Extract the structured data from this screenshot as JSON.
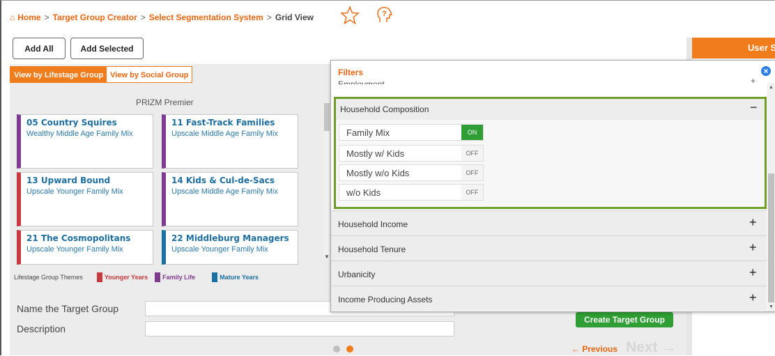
{
  "breadcrumb": {
    "home": "Home",
    "items": [
      "Target Group Creator",
      "Select Segmentation System"
    ],
    "current": "Grid View",
    "separator": ">"
  },
  "icons": {
    "home": "home-icon",
    "star": "star-icon",
    "help": "help-head-icon",
    "close": "close-icon"
  },
  "toolbar": {
    "add_all": "Add All",
    "add_selected": "Add Selected",
    "user_tab": "User S"
  },
  "view_tabs": [
    {
      "label": "View by Lifestage Group",
      "active": true
    },
    {
      "label": "View by Social Group",
      "active": false
    }
  ],
  "grid": {
    "title": "PRIZM Premier",
    "segments": [
      {
        "name": "05 Country Squires",
        "desc": "Wealthy Middle Age Family Mix",
        "theme": "purple"
      },
      {
        "name": "11 Fast-Track Families",
        "desc": "Upscale Middle Age Family Mix",
        "theme": "purple"
      },
      {
        "name": "13 Upward Bound",
        "desc": "Upscale Younger Family Mix",
        "theme": "red"
      },
      {
        "name": "14 Kids & Cul-de-Sacs",
        "desc": "Upscale Middle Age Family Mix",
        "theme": "purple"
      },
      {
        "name": "21 The Cosmopolitans",
        "desc": "Upscale Younger Family Mix",
        "theme": "red"
      },
      {
        "name": "22 Middleburg Managers",
        "desc": "Upscale Younger Family Mix",
        "theme": "blue"
      }
    ]
  },
  "legend": {
    "label": "Lifestage Group Themes",
    "items": [
      {
        "label": "Younger Years",
        "color": "#c8383f"
      },
      {
        "label": "Family Life",
        "color": "#7d3a8e"
      },
      {
        "label": "Mature Years",
        "color": "#1b6fa2"
      }
    ]
  },
  "form": {
    "name_label": "Name the Target Group",
    "name_value": "",
    "desc_label": "Description",
    "desc_value": ""
  },
  "actions": {
    "create": "Create Target Group",
    "previous": "← Previous",
    "next": "Next →"
  },
  "pager": {
    "pages": 2,
    "current": 2
  },
  "filters": {
    "title": "Filters",
    "peek_section": "Employment",
    "expanded": {
      "title": "Household Composition",
      "collapse_symbol": "−",
      "options": [
        {
          "label": "Family Mix",
          "state": "ON"
        },
        {
          "label": "Mostly w/ Kids",
          "state": "OFF"
        },
        {
          "label": "Mostly w/o Kids",
          "state": "OFF"
        },
        {
          "label": "w/o Kids",
          "state": "OFF"
        }
      ]
    },
    "collapsed": [
      {
        "title": "Household Income",
        "symbol": "+"
      },
      {
        "title": "Household Tenure",
        "symbol": "+"
      },
      {
        "title": "Urbanicity",
        "symbol": "+"
      },
      {
        "title": "Income Producing Assets",
        "symbol": "+"
      }
    ]
  },
  "colors": {
    "accent": "#e8650f",
    "orange_bar": "#f07c1b",
    "green": "#2f9e34",
    "highlight": "#6e9e27"
  }
}
